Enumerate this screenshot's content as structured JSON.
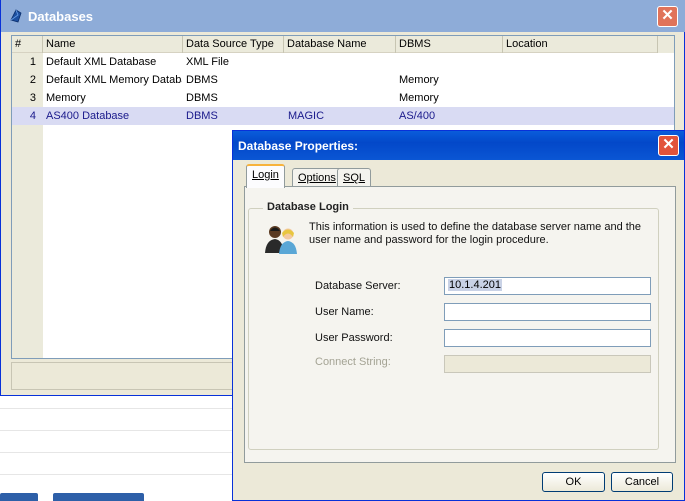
{
  "databases_window": {
    "title": "Databases",
    "columns": [
      "#",
      "Name",
      "Data Source Type",
      "Database Name",
      "DBMS",
      "Location"
    ],
    "rows": [
      {
        "num": "1",
        "name": "Default XML Database",
        "type": "XML File",
        "db_name": "",
        "dbms": "",
        "location": ""
      },
      {
        "num": "2",
        "name": "Default XML Memory Database",
        "type": "DBMS",
        "db_name": "",
        "dbms": "Memory",
        "location": ""
      },
      {
        "num": "3",
        "name": "Memory",
        "type": "DBMS",
        "db_name": "",
        "dbms": "Memory",
        "location": ""
      },
      {
        "num": "4",
        "name": "AS400 Database",
        "type": "DBMS",
        "db_name": "MAGIC",
        "dbms": "AS/400",
        "location": ""
      }
    ],
    "selected_row": 4
  },
  "properties_dialog": {
    "title": "Database Properties:",
    "tabs": [
      "Login",
      "Options",
      "SQL"
    ],
    "active_tab": "Login",
    "group_title": "Database Login",
    "info_text": "This information is used to define the database server name and the user name and password for the login procedure.",
    "fields": {
      "server_label": "Database Server:",
      "server_value": "10.1.4.201",
      "user_label": "User Name:",
      "user_value": "",
      "password_label": "User Password:",
      "password_value": "",
      "connect_label": "Connect String:",
      "connect_value": ""
    },
    "ok_label": "OK",
    "cancel_label": "Cancel"
  },
  "colors": {
    "selection_row": "#d9dbf3",
    "selection_text": "#1a1a8c",
    "dialog_titlebar": "#0348c9",
    "inactive_titlebar": "#8eacd8",
    "close_button": "#e0735a"
  }
}
